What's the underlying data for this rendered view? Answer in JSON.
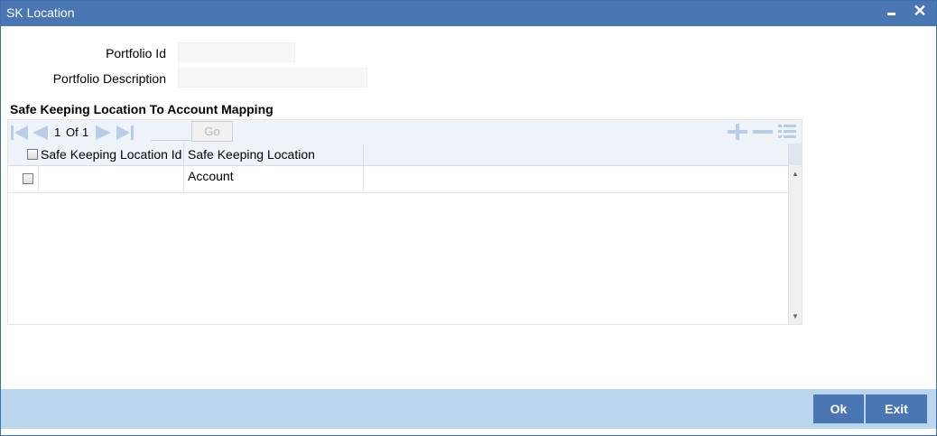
{
  "window": {
    "title": "SK Location"
  },
  "form": {
    "portfolio_id_label": "Portfolio Id",
    "portfolio_id_value": "",
    "portfolio_desc_label": "Portfolio Description",
    "portfolio_desc_value": ""
  },
  "grid": {
    "section_title": "Safe Keeping Location To Account Mapping",
    "pager": {
      "current": "1",
      "of_label": "Of",
      "total": "1",
      "go_label": "Go",
      "page_input": ""
    },
    "columns": [
      "Safe Keeping Location Id",
      "Safe Keeping Location Account"
    ],
    "rows": [
      {
        "location_id": "",
        "location_account": ""
      }
    ]
  },
  "footer": {
    "ok_label": "Ok",
    "exit_label": "Exit"
  },
  "colors": {
    "titlebar": "#4a76b4",
    "footer": "#b9d6ec",
    "button": "#4a76b4",
    "toolbar": "#eef3fa"
  }
}
